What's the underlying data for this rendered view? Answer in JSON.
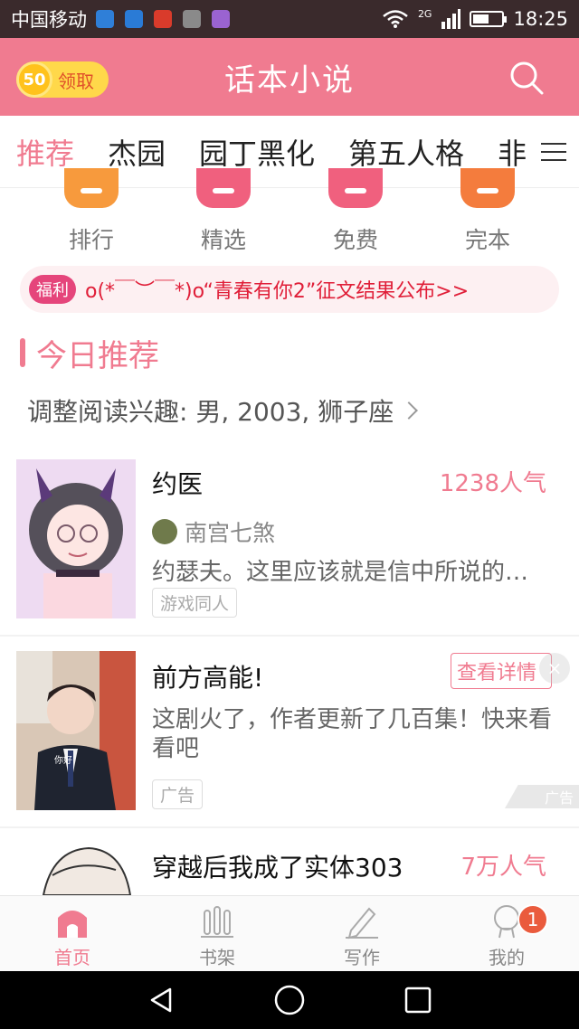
{
  "status_bar": {
    "carrier": "中国移动",
    "network": "2G",
    "time": "18:25",
    "battery_level": 0.5,
    "app_icon_colors": [
      "#2f7fd8",
      "#2a7bd6",
      "#d93b2b",
      "#8a8a8a",
      "#9a63d1"
    ]
  },
  "header": {
    "coin_value": "50",
    "coin_label": "领取",
    "title": "话本小说",
    "search_icon": "search-icon",
    "accent": "#f07b90"
  },
  "tabs": {
    "items": [
      "推荐",
      "杰园",
      "园丁黑化",
      "第五人格",
      "非"
    ],
    "active": 0,
    "menu_icon": "menu-icon"
  },
  "quick": {
    "items": [
      {
        "label": "排行",
        "color": "#f79a3d"
      },
      {
        "label": "精选",
        "color": "#f0607e"
      },
      {
        "label": "免费",
        "color": "#f0607e"
      },
      {
        "label": "完本",
        "color": "#f47c3d"
      }
    ]
  },
  "notice": {
    "badge": "福利",
    "text": "o(*￣︶￣*)o“青春有你2”征文结果公布>>"
  },
  "section": {
    "title": "今日推荐",
    "interest": "调整阅读兴趣: 男, 2003, 狮子座"
  },
  "books": [
    {
      "title": "约医",
      "popularity": "1238人气",
      "author": "南宫七煞",
      "desc": "约瑟夫。这里应该就是信中所说的…",
      "tag": "游戏同人"
    },
    {
      "title": "穿越后我成了实体303",
      "popularity": "7万人气"
    }
  ],
  "ad": {
    "title": "前方高能!",
    "desc": "这剧火了，作者更新了几百集！快来看看吧",
    "tag": "广告",
    "detail": "查看详情",
    "close": "×",
    "mark": "广告",
    "cover_caption": "你好"
  },
  "bottom_nav": {
    "items": [
      {
        "label": "首页",
        "icon": "home-icon"
      },
      {
        "label": "书架",
        "icon": "bookshelf-icon"
      },
      {
        "label": "写作",
        "icon": "pencil-icon"
      },
      {
        "label": "我的",
        "icon": "profile-icon"
      }
    ],
    "active": 0,
    "badge": "1"
  }
}
